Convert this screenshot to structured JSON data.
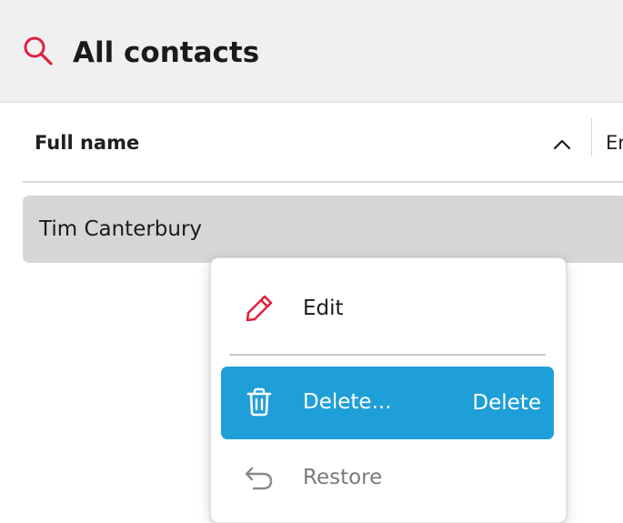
{
  "header": {
    "title": "All contacts",
    "icon": "search-icon",
    "icon_color": "#e02041"
  },
  "table": {
    "columns": [
      {
        "label": "Full name",
        "sort": "ascending"
      },
      {
        "label": "Er"
      }
    ],
    "rows": [
      {
        "full_name": "Tim Canterbury",
        "selected": true
      }
    ]
  },
  "context_menu": {
    "items": [
      {
        "label": "Edit",
        "icon": "pencil-icon",
        "enabled": true
      },
      {
        "label": "Delete...",
        "shortcut": "Delete",
        "icon": "trash-icon",
        "highlighted": true,
        "enabled": true
      },
      {
        "label": "Restore",
        "icon": "undo-icon",
        "enabled": false
      }
    ]
  },
  "colors": {
    "accent": "#1f9fd8",
    "brand_red": "#e02041",
    "header_bg": "#f0f0f0",
    "selected_row_bg": "#d6d6d6"
  }
}
